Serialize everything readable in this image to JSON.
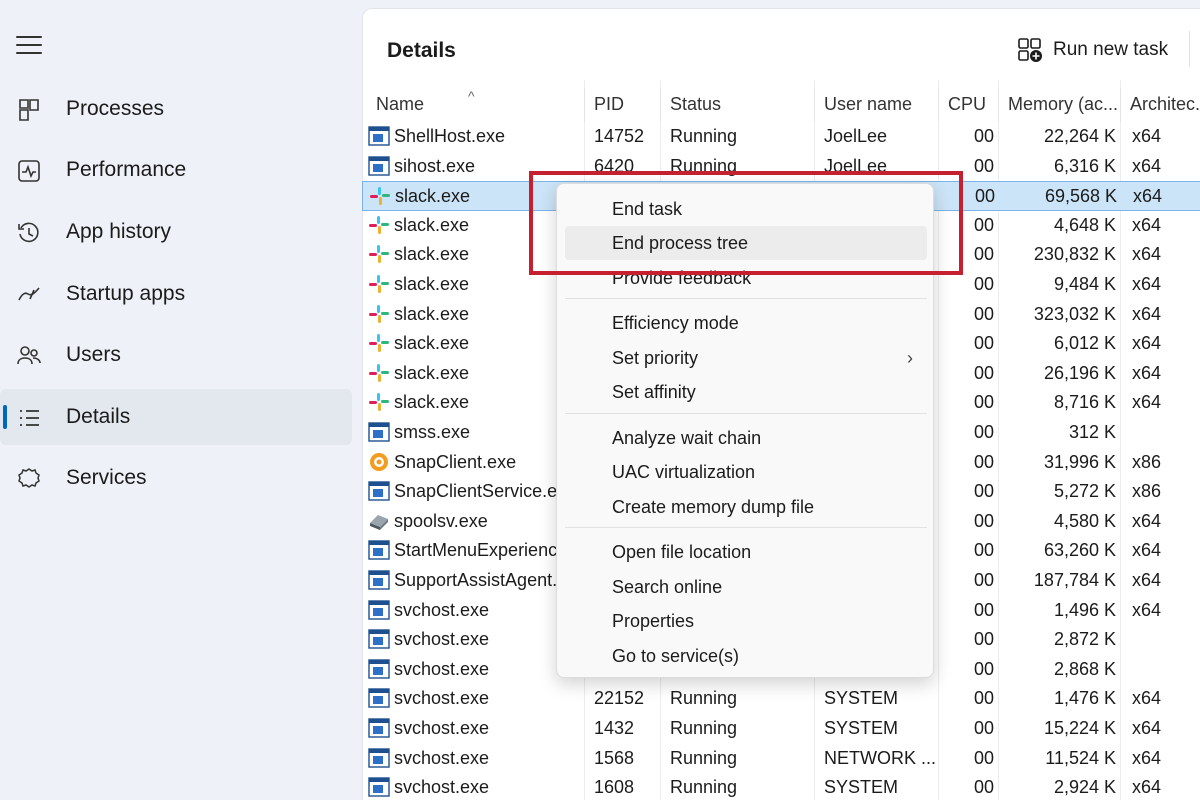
{
  "sidebar": {
    "items": [
      {
        "label": "Processes",
        "icon": "processes-icon"
      },
      {
        "label": "Performance",
        "icon": "performance-icon"
      },
      {
        "label": "App history",
        "icon": "app-history-icon"
      },
      {
        "label": "Startup apps",
        "icon": "startup-apps-icon"
      },
      {
        "label": "Users",
        "icon": "users-icon"
      },
      {
        "label": "Details",
        "icon": "details-icon",
        "active": true
      },
      {
        "label": "Services",
        "icon": "services-icon"
      }
    ]
  },
  "header": {
    "title": "Details",
    "run_new_task": "Run new task"
  },
  "table": {
    "columns": [
      "Name",
      "PID",
      "Status",
      "User name",
      "CPU",
      "Memory (ac...",
      "Architec..."
    ],
    "rows": [
      {
        "name": "ShellHost.exe",
        "pid": "14752",
        "status": "Running",
        "user": "JoelLee",
        "cpu": "00",
        "mem": "22,264 K",
        "arch": "x64",
        "icon": "window"
      },
      {
        "name": "sihost.exe",
        "pid": "6420",
        "status": "Running",
        "user": "JoelLee",
        "cpu": "00",
        "mem": "6,316 K",
        "arch": "x64",
        "icon": "window"
      },
      {
        "name": "slack.exe",
        "pid": "",
        "status": "",
        "user": "",
        "cpu": "00",
        "mem": "69,568 K",
        "arch": "x64",
        "icon": "slack"
      },
      {
        "name": "slack.exe",
        "pid": "",
        "status": "",
        "user": "",
        "cpu": "00",
        "mem": "4,648 K",
        "arch": "x64",
        "icon": "slack"
      },
      {
        "name": "slack.exe",
        "pid": "",
        "status": "",
        "user": "",
        "cpu": "00",
        "mem": "230,832 K",
        "arch": "x64",
        "icon": "slack"
      },
      {
        "name": "slack.exe",
        "pid": "",
        "status": "",
        "user": "",
        "cpu": "00",
        "mem": "9,484 K",
        "arch": "x64",
        "icon": "slack"
      },
      {
        "name": "slack.exe",
        "pid": "",
        "status": "",
        "user": "",
        "cpu": "00",
        "mem": "323,032 K",
        "arch": "x64",
        "icon": "slack"
      },
      {
        "name": "slack.exe",
        "pid": "",
        "status": "",
        "user": "",
        "cpu": "00",
        "mem": "6,012 K",
        "arch": "x64",
        "icon": "slack"
      },
      {
        "name": "slack.exe",
        "pid": "",
        "status": "",
        "user": "",
        "cpu": "00",
        "mem": "26,196 K",
        "arch": "x64",
        "icon": "slack"
      },
      {
        "name": "slack.exe",
        "pid": "",
        "status": "",
        "user": "",
        "cpu": "00",
        "mem": "8,716 K",
        "arch": "x64",
        "icon": "slack"
      },
      {
        "name": "smss.exe",
        "pid": "",
        "status": "",
        "user": "",
        "cpu": "00",
        "mem": "312 K",
        "arch": "",
        "icon": "window"
      },
      {
        "name": "SnapClient.exe",
        "pid": "",
        "status": "",
        "user": "",
        "cpu": "00",
        "mem": "31,996 K",
        "arch": "x86",
        "icon": "snap"
      },
      {
        "name": "SnapClientService.exe",
        "pid": "",
        "status": "",
        "user": "",
        "cpu": "00",
        "mem": "5,272 K",
        "arch": "x86",
        "icon": "window"
      },
      {
        "name": "spoolsv.exe",
        "pid": "",
        "status": "",
        "user": "",
        "cpu": "00",
        "mem": "4,580 K",
        "arch": "x64",
        "icon": "printer"
      },
      {
        "name": "StartMenuExperienceHost.exe",
        "pid": "",
        "status": "",
        "user": "",
        "cpu": "00",
        "mem": "63,260 K",
        "arch": "x64",
        "icon": "window"
      },
      {
        "name": "SupportAssistAgent.exe",
        "pid": "",
        "status": "",
        "user": "",
        "cpu": "00",
        "mem": "187,784 K",
        "arch": "x64",
        "icon": "window"
      },
      {
        "name": "svchost.exe",
        "pid": "",
        "status": "",
        "user": "",
        "cpu": "00",
        "mem": "1,496 K",
        "arch": "x64",
        "icon": "window"
      },
      {
        "name": "svchost.exe",
        "pid": "",
        "status": "",
        "user": "",
        "cpu": "00",
        "mem": "2,872 K",
        "arch": "",
        "icon": "window"
      },
      {
        "name": "svchost.exe",
        "pid": "",
        "status": "",
        "user": "",
        "cpu": "00",
        "mem": "2,868 K",
        "arch": "",
        "icon": "window"
      },
      {
        "name": "svchost.exe",
        "pid": "22152",
        "status": "Running",
        "user": "SYSTEM",
        "cpu": "00",
        "mem": "1,476 K",
        "arch": "x64",
        "icon": "window"
      },
      {
        "name": "svchost.exe",
        "pid": "1432",
        "status": "Running",
        "user": "SYSTEM",
        "cpu": "00",
        "mem": "15,224 K",
        "arch": "x64",
        "icon": "window"
      },
      {
        "name": "svchost.exe",
        "pid": "1568",
        "status": "Running",
        "user": "NETWORK ...",
        "cpu": "00",
        "mem": "11,524 K",
        "arch": "x64",
        "icon": "window"
      },
      {
        "name": "svchost.exe",
        "pid": "1608",
        "status": "Running",
        "user": "SYSTEM",
        "cpu": "00",
        "mem": "2,924 K",
        "arch": "x64",
        "icon": "window"
      }
    ],
    "selected_index": 2
  },
  "context_menu": {
    "groups": [
      [
        "End task",
        "End process tree",
        "Provide feedback"
      ],
      [
        "Efficiency mode",
        "Set priority",
        "Set affinity"
      ],
      [
        "Analyze wait chain",
        "UAC virtualization",
        "Create memory dump file"
      ],
      [
        "Open file location",
        "Search online",
        "Properties",
        "Go to service(s)"
      ]
    ],
    "hovered": "End process tree",
    "submenu_item": "Set priority"
  },
  "colors": {
    "accent": "#0067c0",
    "selection": "#cce4f7",
    "highlight_box": "#c5202f",
    "sidebar_bg": "#eef2f8"
  }
}
